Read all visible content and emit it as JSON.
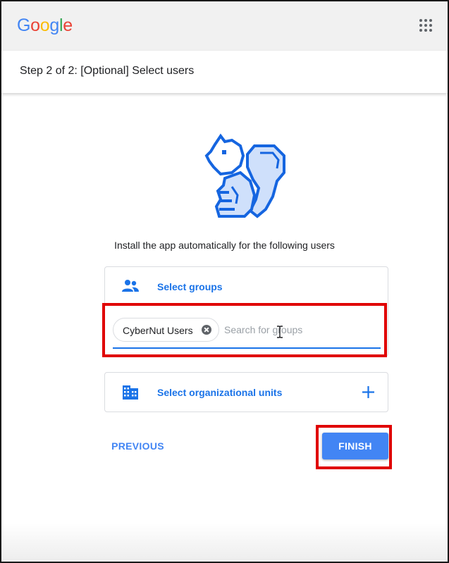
{
  "brand": {
    "letters": [
      {
        "char": "G",
        "color": "#4285F4"
      },
      {
        "char": "o",
        "color": "#EA4335"
      },
      {
        "char": "o",
        "color": "#FBBC05"
      },
      {
        "char": "g",
        "color": "#4285F4"
      },
      {
        "char": "l",
        "color": "#34A853"
      },
      {
        "char": "e",
        "color": "#EA4335"
      }
    ]
  },
  "header": {
    "apps_icon": "apps-grid-icon"
  },
  "step": {
    "title": "Step 2 of 2: [Optional] Select users"
  },
  "mascot": {
    "icon": "squirrel-icon"
  },
  "install": {
    "text": "Install the app automatically for the following users"
  },
  "groups": {
    "icon": "people-icon",
    "label": "Select groups",
    "chips": [
      {
        "label": "CyberNut Users"
      }
    ],
    "search_placeholder": "Search for groups",
    "search_value": ""
  },
  "org_units": {
    "icon": "building-icon",
    "label": "Select organizational units",
    "add_icon": "plus-icon"
  },
  "actions": {
    "previous_label": "PREVIOUS",
    "finish_label": "FINISH"
  },
  "colors": {
    "accent": "#4285f4",
    "link": "#1a73e8",
    "highlight": "#e00000",
    "mascot_outline": "#1565e0",
    "mascot_fill": "#cfe0fb"
  }
}
